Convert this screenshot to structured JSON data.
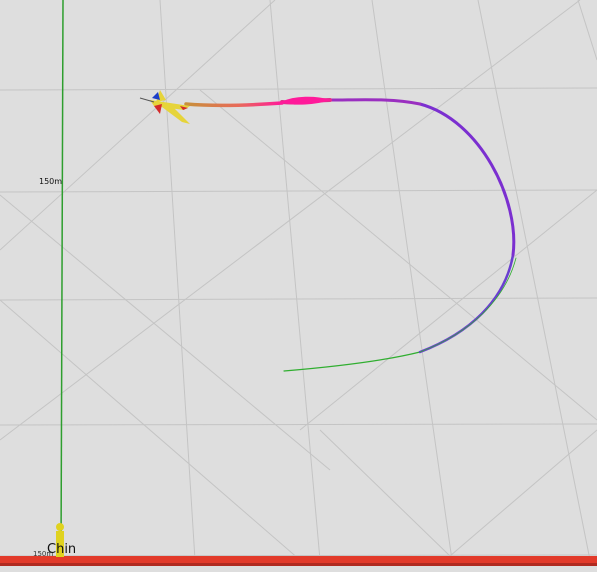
{
  "scene": {
    "altitude_label": "150m",
    "pilot_label": "Chin",
    "range_label": "150m",
    "ground_color": "#dedede",
    "grid_color": "#c4c4c4",
    "runway_color": "#e23a2a",
    "pole_color": "#2e9e2e"
  },
  "trail": {
    "colors": [
      "#2fae2f",
      "#7b2fd0",
      "#b82fb8",
      "#e0308a",
      "#ff1a9a",
      "#c89030"
    ]
  },
  "aircraft": {
    "icon": "airplane-icon",
    "colors": [
      "#e6d43a",
      "#d42a2a",
      "#1d3fc9"
    ]
  }
}
